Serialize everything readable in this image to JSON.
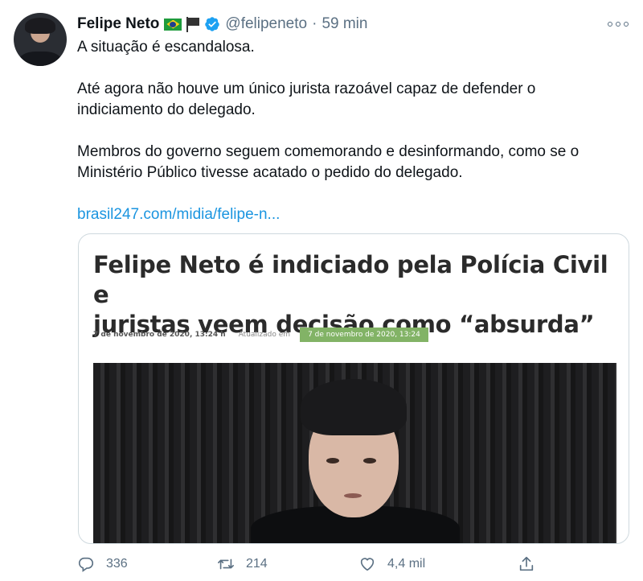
{
  "tweet": {
    "author_name": "Felipe Neto",
    "handle": "@felipeneto",
    "separator": "·",
    "time": "59 min",
    "lines": {
      "p1": "A situação é escandalosa.",
      "p2_l1": "Até agora não houve um único jurista razoável capaz de defender o",
      "p2_l2": "indiciamento do delegado.",
      "p3_l1": "Membros do governo seguem comemorando e desinformando, como se o",
      "p3_l2": "Ministério Público tivesse acatado o pedido do delegado."
    },
    "link": "brasil247.com/midia/felipe-n..."
  },
  "card": {
    "title_l1": "Felipe Neto é indiciado pela Polícia Civil e",
    "title_l2": "juristas veem decisão como “absurda”",
    "published": "7 de novembro de 2020, 13:24 h",
    "updated_label": "Atualizado em",
    "updated_value": "7 de novembro de 2020, 13:24"
  },
  "actions": {
    "replies": "336",
    "retweets": "214",
    "likes": "4,4 mil"
  },
  "icons": {
    "verified": "verified-badge-icon",
    "more": "more-icon",
    "reply": "reply-icon",
    "retweet": "retweet-icon",
    "like": "heart-icon",
    "share": "share-icon"
  },
  "colors": {
    "link": "#1b95e0",
    "verified": "#1da1f2",
    "secondary_text": "#5b7083",
    "badge": "#82b366"
  }
}
